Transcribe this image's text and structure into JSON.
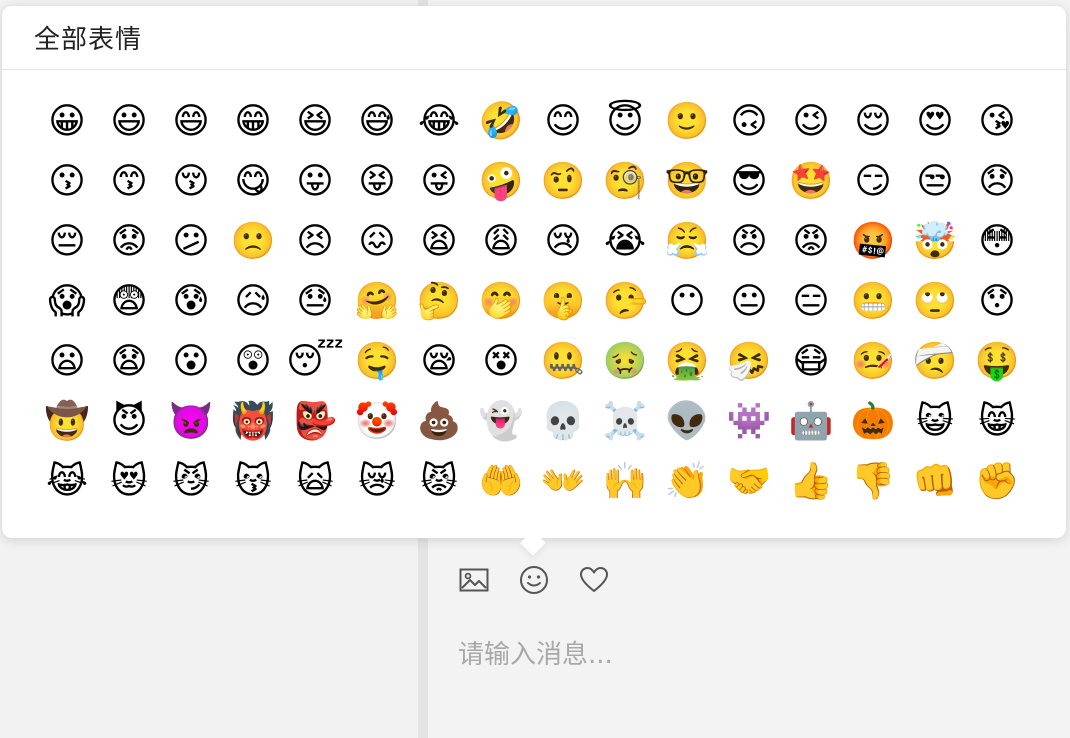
{
  "panel": {
    "title": "全部表情"
  },
  "emojis": [
    "😀",
    "😃",
    "😄",
    "😁",
    "😆",
    "😅",
    "😂",
    "🤣",
    "😊",
    "😇",
    "🙂",
    "🙃",
    "😉",
    "😌",
    "😍",
    "😘",
    "😗",
    "😙",
    "😚",
    "😋",
    "😛",
    "😝",
    "😜",
    "🤪",
    "🤨",
    "🧐",
    "🤓",
    "😎",
    "🤩",
    "😏",
    "😒",
    "😞",
    "😔",
    "😟",
    "😕",
    "🙁",
    "😣",
    "😖",
    "😫",
    "😩",
    "😢",
    "😭",
    "😤",
    "😠",
    "😡",
    "🤬",
    "🤯",
    "😳",
    "😱",
    "😨",
    "😰",
    "😥",
    "😓",
    "🤗",
    "🤔",
    "🤭",
    "🤫",
    "🤥",
    "😶",
    "😐",
    "😑",
    "😬",
    "🙄",
    "😯",
    "😦",
    "😧",
    "😮",
    "😲",
    "😴",
    "🤤",
    "😪",
    "😵",
    "🤐",
    "🤢",
    "🤮",
    "🤧",
    "😷",
    "🤒",
    "🤕",
    "🤑",
    "🤠",
    "😈",
    "👿",
    "👹",
    "👺",
    "🤡",
    "💩",
    "👻",
    "💀",
    "☠️",
    "👽",
    "👾",
    "🤖",
    "🎃",
    "😺",
    "😸",
    "😹",
    "😻",
    "😼",
    "😽",
    "🙀",
    "😿",
    "😾",
    "🤲",
    "👐",
    "🙌",
    "👏",
    "🤝",
    "👍",
    "👎",
    "👊",
    "✊"
  ],
  "toolbar": {
    "image_icon": "image-icon",
    "emoji_icon": "smiley-icon",
    "favorite_icon": "heart-icon"
  },
  "input": {
    "placeholder": "请输入消息..."
  },
  "colors": {
    "popup_bg": "#ffffff",
    "icon": "#555555",
    "placeholder": "#a8a8a8"
  }
}
